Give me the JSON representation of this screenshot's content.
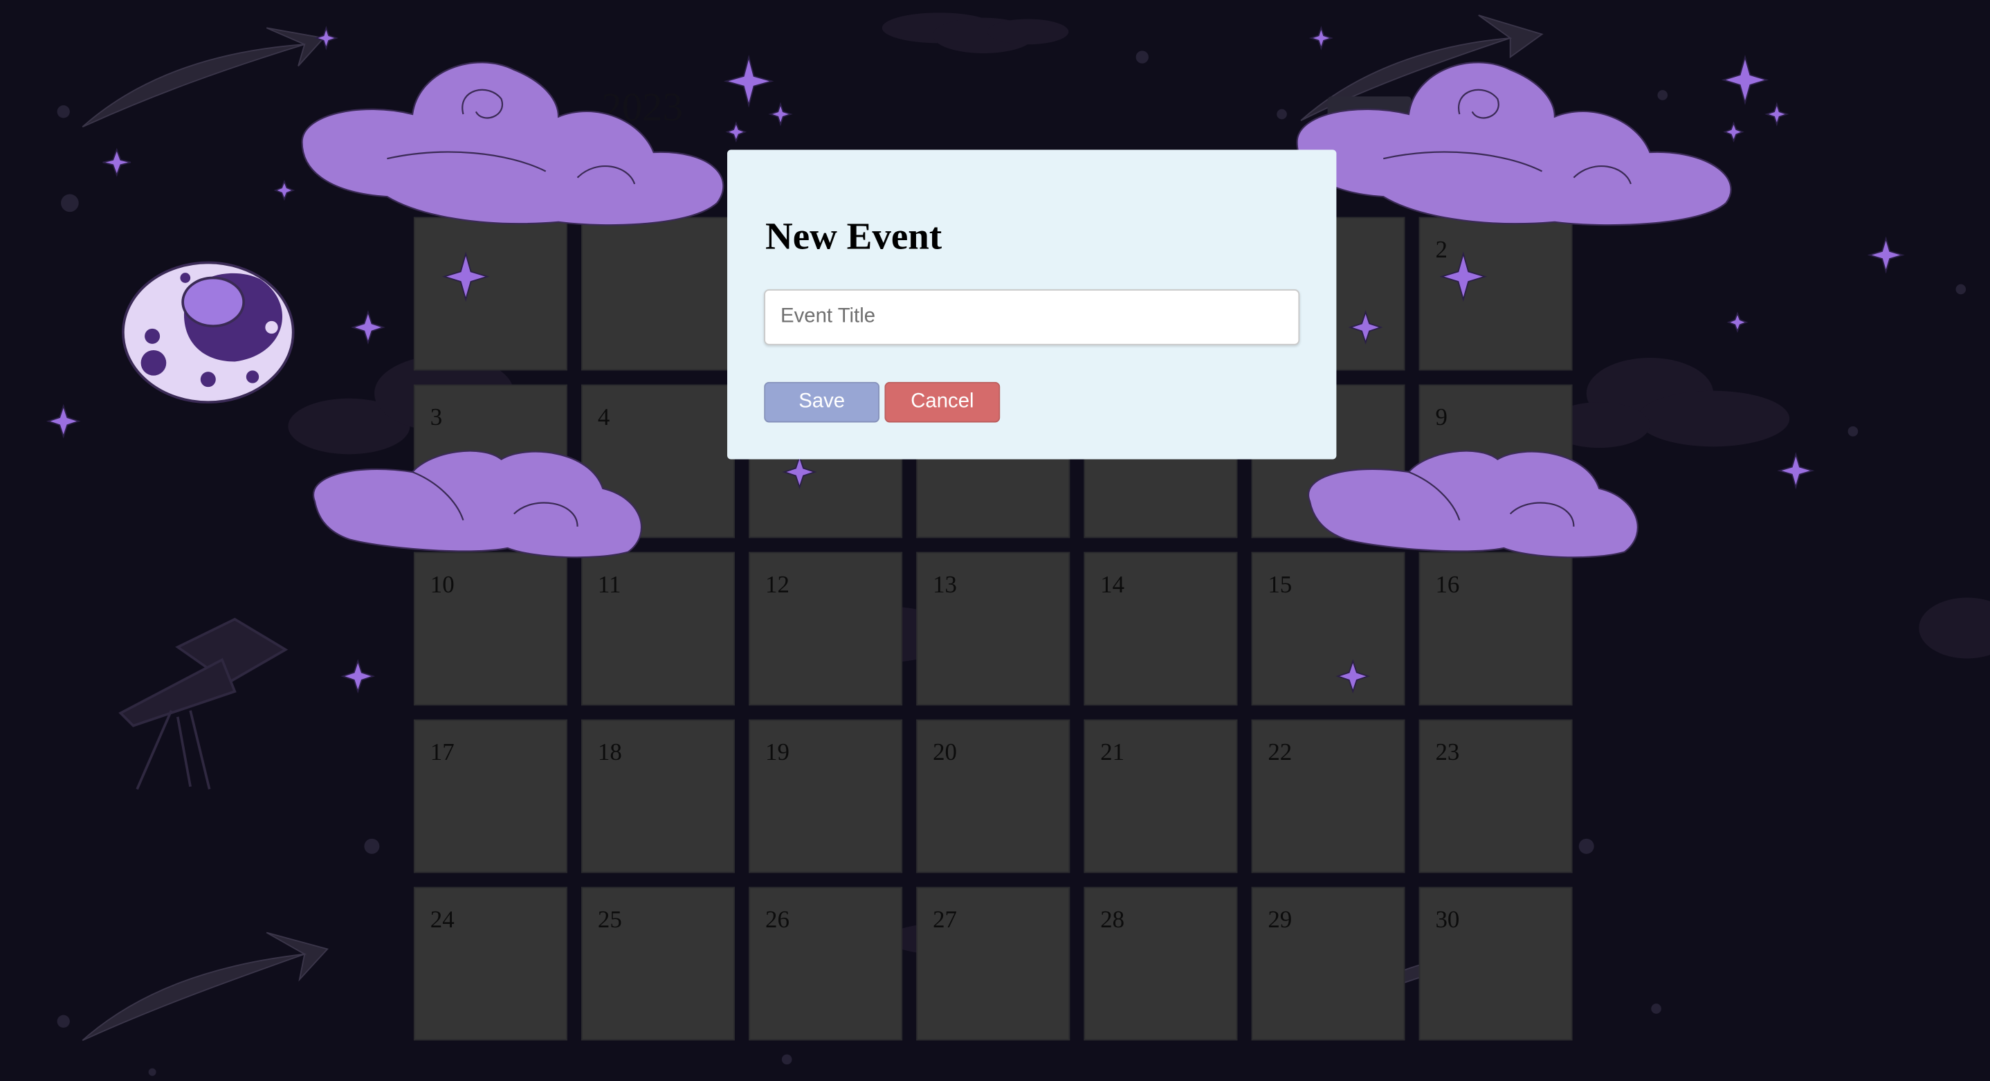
{
  "calendar": {
    "year": "2023",
    "days": [
      {
        "num": ""
      },
      {
        "num": ""
      },
      {
        "num": ""
      },
      {
        "num": ""
      },
      {
        "num": ""
      },
      {
        "num": ""
      },
      {
        "num": "2"
      },
      {
        "num": "3"
      },
      {
        "num": "4"
      },
      {
        "num": ""
      },
      {
        "num": ""
      },
      {
        "num": ""
      },
      {
        "num": ""
      },
      {
        "num": "9"
      },
      {
        "num": "10"
      },
      {
        "num": "11"
      },
      {
        "num": "12"
      },
      {
        "num": "13"
      },
      {
        "num": "14"
      },
      {
        "num": "15"
      },
      {
        "num": "16"
      },
      {
        "num": "17"
      },
      {
        "num": "18"
      },
      {
        "num": "19"
      },
      {
        "num": "20"
      },
      {
        "num": "21"
      },
      {
        "num": "22"
      },
      {
        "num": "23"
      },
      {
        "num": "24"
      },
      {
        "num": "25"
      },
      {
        "num": "26"
      },
      {
        "num": "27"
      },
      {
        "num": "28"
      },
      {
        "num": "29"
      },
      {
        "num": "30"
      }
    ]
  },
  "modal": {
    "title": "New Event",
    "input_value": "",
    "input_placeholder": "Event Title",
    "save_label": "Save",
    "cancel_label": "Cancel"
  },
  "colors": {
    "background": "#0f0d1b",
    "cell": "#353535",
    "modal_bg": "#e6f3f9",
    "save": "#98a6d4",
    "cancel": "#d56b6b",
    "cloud": "#a07ad6",
    "star": "#9b6fe0",
    "moon": "#e3d6f5"
  },
  "decorations": {
    "icons": [
      "moon-icon",
      "cloud-icon",
      "star-icon",
      "shooting-star-icon",
      "telescope-icon"
    ]
  }
}
